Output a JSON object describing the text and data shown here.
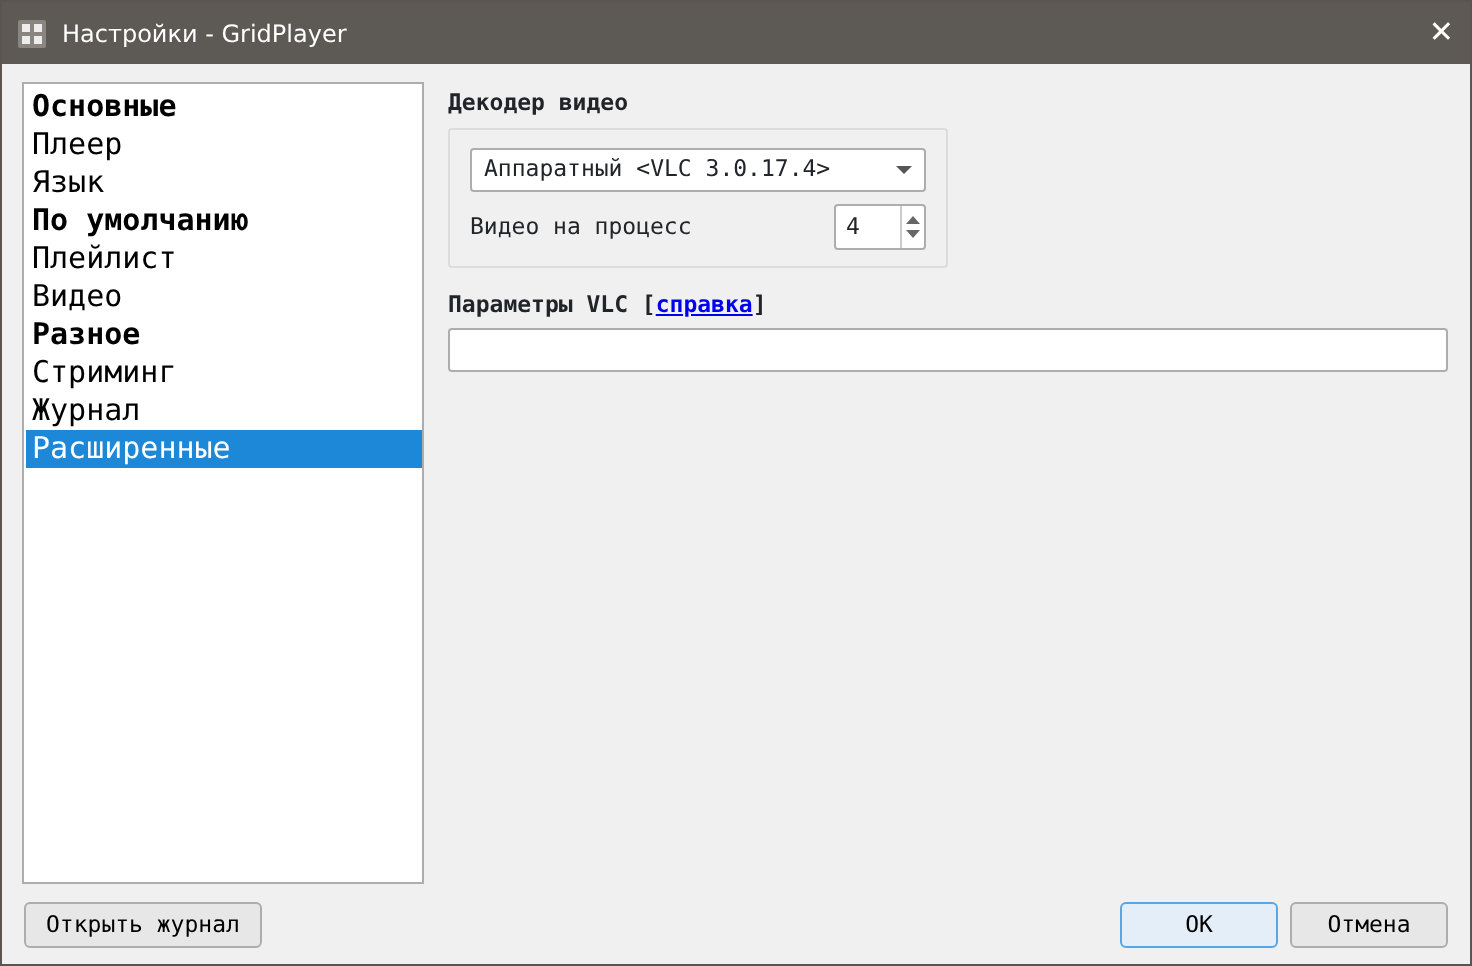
{
  "window": {
    "title": "Настройки - GridPlayer",
    "close": "✕"
  },
  "sidebar": {
    "items": [
      {
        "label": "Основные",
        "kind": "header",
        "selected": false
      },
      {
        "label": "Плеер",
        "kind": "item",
        "selected": false
      },
      {
        "label": "Язык",
        "kind": "item",
        "selected": false
      },
      {
        "label": "По умолчанию",
        "kind": "header",
        "selected": false
      },
      {
        "label": "Плейлист",
        "kind": "item",
        "selected": false
      },
      {
        "label": "Видео",
        "kind": "item",
        "selected": false
      },
      {
        "label": "Разное",
        "kind": "header",
        "selected": false
      },
      {
        "label": "Стриминг",
        "kind": "item",
        "selected": false
      },
      {
        "label": "Журнал",
        "kind": "item",
        "selected": false
      },
      {
        "label": "Расширенные",
        "kind": "item",
        "selected": true
      }
    ]
  },
  "decoder": {
    "title": "Декодер видео",
    "combo_value": "Аппаратный <VLC 3.0.17.4>",
    "per_process_label": "Видео на процесс",
    "per_process_value": "4"
  },
  "vlc_params": {
    "prefix": "Параметры VLC [",
    "link": "справка",
    "suffix": "]"
  },
  "buttons": {
    "open_log": "Открыть журнал",
    "ok": "OK",
    "cancel": "Отмена"
  }
}
